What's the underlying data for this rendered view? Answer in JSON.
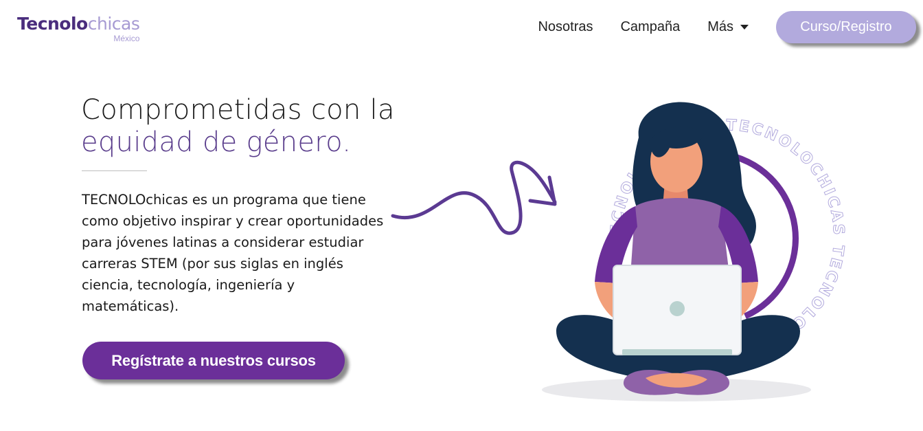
{
  "header": {
    "logo": {
      "bold": "Tecnolo",
      "light": "chicas",
      "sub": "México"
    },
    "nav": [
      {
        "label": "Nosotras"
      },
      {
        "label": "Campaña"
      },
      {
        "label": "Más"
      }
    ],
    "cta_label": "Curso/Registro"
  },
  "hero": {
    "headline_line1": "Comprometidas con la",
    "headline_line2": "equidad de género.",
    "description": "TECNOLOchicas es un programa que tiene como objetivo inspirar y crear oportunidades para jóvenes latinas a considerar estudiar carreras STEM (por sus siglas en inglés ciencia, tecnología, ingeniería y matemáticas).",
    "cta_label": "Regístrate a nuestros cursos"
  },
  "illustration": {
    "ring_text": "TECNOLOCHICAS",
    "colors": {
      "purple": "#6b2f99",
      "lavender": "#b2aadd",
      "hair": "#14304f",
      "skin": "#f2a07b"
    }
  }
}
